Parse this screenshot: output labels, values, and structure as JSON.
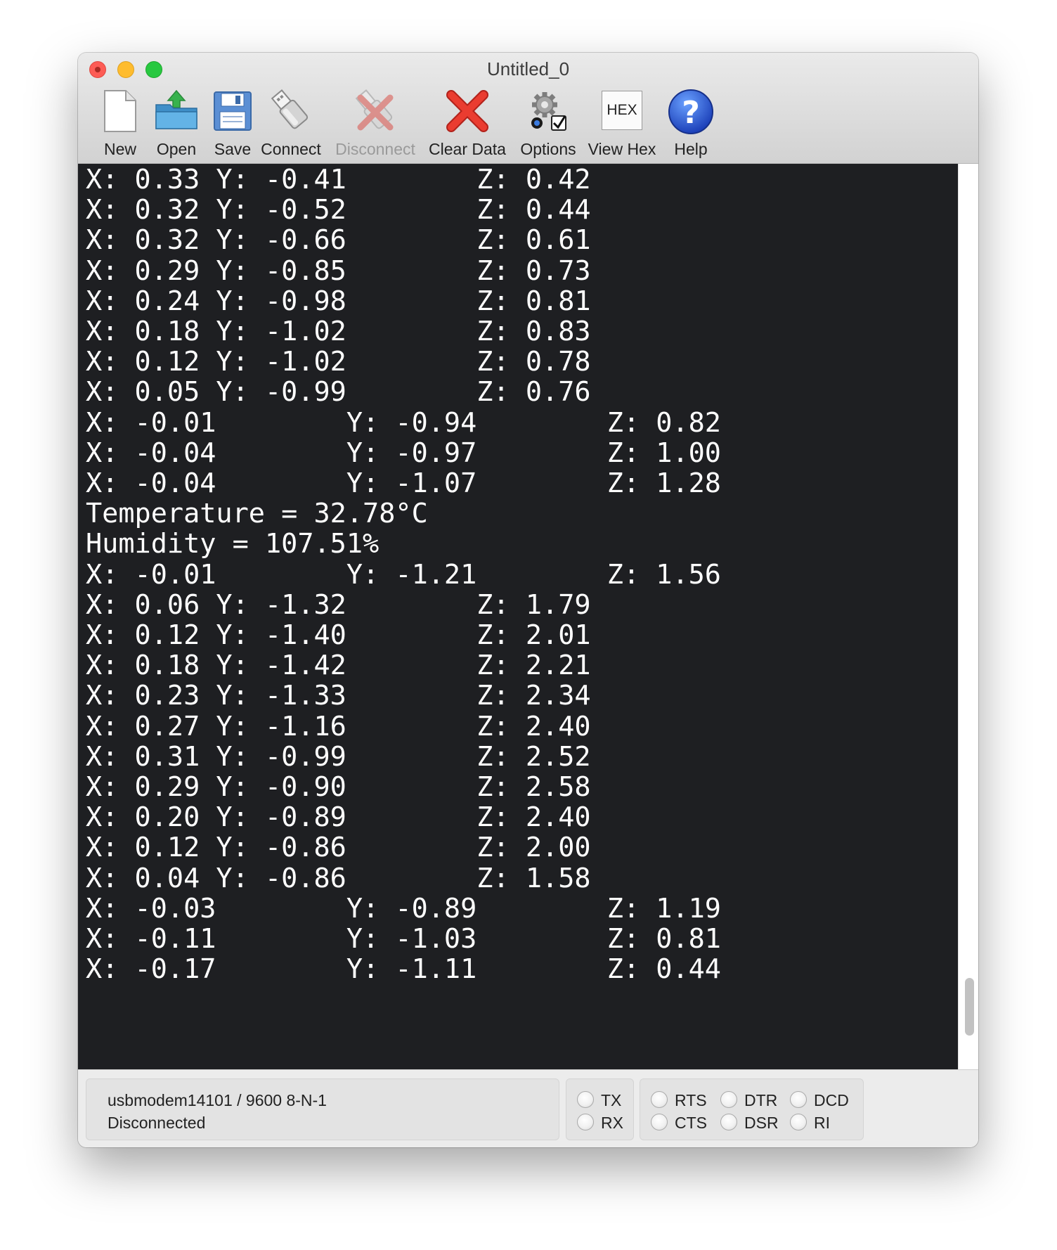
{
  "window": {
    "title": "Untitled_0"
  },
  "toolbar": {
    "new_label": "New",
    "open_label": "Open",
    "save_label": "Save",
    "connect_label": "Connect",
    "disconnect_label": "Disconnect",
    "clear_label": "Clear Data",
    "options_label": "Options",
    "viewhex_label": "View Hex",
    "viewhex_icon_text": "HEX",
    "help_label": "Help",
    "disconnect_enabled": false
  },
  "terminal": {
    "lines": [
      "X: 0.33 Y: -0.41        Z: 0.42",
      "X: 0.32 Y: -0.52        Z: 0.44",
      "X: 0.32 Y: -0.66        Z: 0.61",
      "X: 0.29 Y: -0.85        Z: 0.73",
      "X: 0.24 Y: -0.98        Z: 0.81",
      "X: 0.18 Y: -1.02        Z: 0.83",
      "X: 0.12 Y: -1.02        Z: 0.78",
      "X: 0.05 Y: -0.99        Z: 0.76",
      "X: -0.01        Y: -0.94        Z: 0.82",
      "X: -0.04        Y: -0.97        Z: 1.00",
      "X: -0.04        Y: -1.07        Z: 1.28",
      "Temperature = 32.78°C",
      "Humidity = 107.51%",
      "X: -0.01        Y: -1.21        Z: 1.56",
      "X: 0.06 Y: -1.32        Z: 1.79",
      "X: 0.12 Y: -1.40        Z: 2.01",
      "X: 0.18 Y: -1.42        Z: 2.21",
      "X: 0.23 Y: -1.33        Z: 2.34",
      "X: 0.27 Y: -1.16        Z: 2.40",
      "X: 0.31 Y: -0.99        Z: 2.52",
      "X: 0.29 Y: -0.90        Z: 2.58",
      "X: 0.20 Y: -0.89        Z: 2.40",
      "X: 0.12 Y: -0.86        Z: 2.00",
      "X: 0.04 Y: -0.86        Z: 1.58",
      "X: -0.03        Y: -0.89        Z: 1.19",
      "X: -0.11        Y: -1.03        Z: 0.81",
      "X: -0.17        Y: -1.11        Z: 0.44"
    ]
  },
  "status": {
    "port": "usbmodem14101 / 9600 8-N-1",
    "connection": "Disconnected",
    "leds": {
      "tx": "TX",
      "rx": "RX",
      "rts": "RTS",
      "cts": "CTS",
      "dtr": "DTR",
      "dsr": "DSR",
      "dcd": "DCD",
      "ri": "RI"
    }
  }
}
